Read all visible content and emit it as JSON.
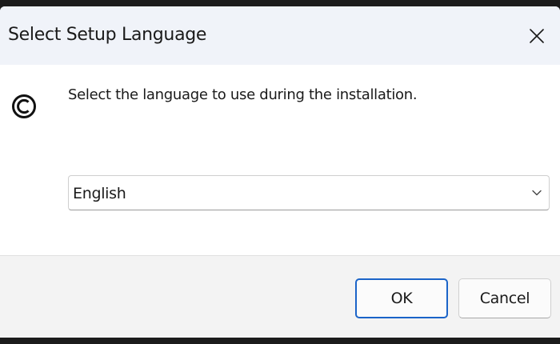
{
  "window": {
    "title": "Select Setup Language",
    "close_icon": "close-icon"
  },
  "content": {
    "app_icon": "copyright-circle-icon",
    "prompt": "Select the language to use during the installation."
  },
  "language_select": {
    "selected": "English",
    "chevron_icon": "chevron-down-icon"
  },
  "buttons": {
    "ok_label": "OK",
    "cancel_label": "Cancel"
  },
  "colors": {
    "accent": "#1b64c8",
    "titlebar_bg": "#f0f3f9",
    "footer_bg": "#f3f3f3"
  }
}
